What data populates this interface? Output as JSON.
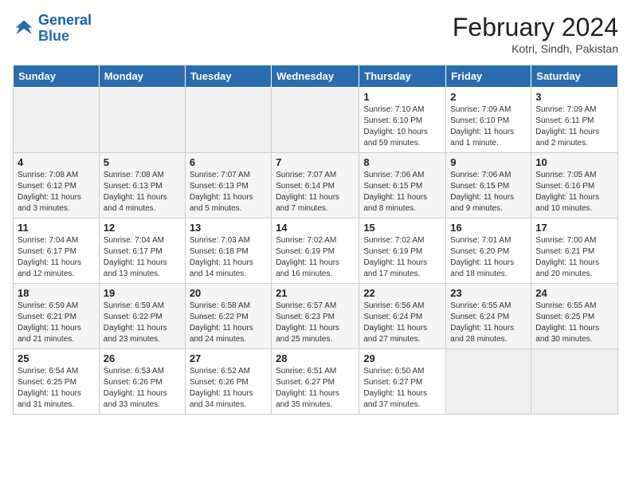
{
  "logo": {
    "line1": "General",
    "line2": "Blue"
  },
  "title": "February 2024",
  "subtitle": "Kotri, Sindh, Pakistan",
  "headers": [
    "Sunday",
    "Monday",
    "Tuesday",
    "Wednesday",
    "Thursday",
    "Friday",
    "Saturday"
  ],
  "weeks": [
    [
      {
        "num": "",
        "info": ""
      },
      {
        "num": "",
        "info": ""
      },
      {
        "num": "",
        "info": ""
      },
      {
        "num": "",
        "info": ""
      },
      {
        "num": "1",
        "info": "Sunrise: 7:10 AM\nSunset: 6:10 PM\nDaylight: 10 hours and 59 minutes."
      },
      {
        "num": "2",
        "info": "Sunrise: 7:09 AM\nSunset: 6:10 PM\nDaylight: 11 hours and 1 minute."
      },
      {
        "num": "3",
        "info": "Sunrise: 7:09 AM\nSunset: 6:11 PM\nDaylight: 11 hours and 2 minutes."
      }
    ],
    [
      {
        "num": "4",
        "info": "Sunrise: 7:08 AM\nSunset: 6:12 PM\nDaylight: 11 hours and 3 minutes."
      },
      {
        "num": "5",
        "info": "Sunrise: 7:08 AM\nSunset: 6:13 PM\nDaylight: 11 hours and 4 minutes."
      },
      {
        "num": "6",
        "info": "Sunrise: 7:07 AM\nSunset: 6:13 PM\nDaylight: 11 hours and 5 minutes."
      },
      {
        "num": "7",
        "info": "Sunrise: 7:07 AM\nSunset: 6:14 PM\nDaylight: 11 hours and 7 minutes."
      },
      {
        "num": "8",
        "info": "Sunrise: 7:06 AM\nSunset: 6:15 PM\nDaylight: 11 hours and 8 minutes."
      },
      {
        "num": "9",
        "info": "Sunrise: 7:06 AM\nSunset: 6:15 PM\nDaylight: 11 hours and 9 minutes."
      },
      {
        "num": "10",
        "info": "Sunrise: 7:05 AM\nSunset: 6:16 PM\nDaylight: 11 hours and 10 minutes."
      }
    ],
    [
      {
        "num": "11",
        "info": "Sunrise: 7:04 AM\nSunset: 6:17 PM\nDaylight: 11 hours and 12 minutes."
      },
      {
        "num": "12",
        "info": "Sunrise: 7:04 AM\nSunset: 6:17 PM\nDaylight: 11 hours and 13 minutes."
      },
      {
        "num": "13",
        "info": "Sunrise: 7:03 AM\nSunset: 6:18 PM\nDaylight: 11 hours and 14 minutes."
      },
      {
        "num": "14",
        "info": "Sunrise: 7:02 AM\nSunset: 6:19 PM\nDaylight: 11 hours and 16 minutes."
      },
      {
        "num": "15",
        "info": "Sunrise: 7:02 AM\nSunset: 6:19 PM\nDaylight: 11 hours and 17 minutes."
      },
      {
        "num": "16",
        "info": "Sunrise: 7:01 AM\nSunset: 6:20 PM\nDaylight: 11 hours and 18 minutes."
      },
      {
        "num": "17",
        "info": "Sunrise: 7:00 AM\nSunset: 6:21 PM\nDaylight: 11 hours and 20 minutes."
      }
    ],
    [
      {
        "num": "18",
        "info": "Sunrise: 6:59 AM\nSunset: 6:21 PM\nDaylight: 11 hours and 21 minutes."
      },
      {
        "num": "19",
        "info": "Sunrise: 6:59 AM\nSunset: 6:22 PM\nDaylight: 11 hours and 23 minutes."
      },
      {
        "num": "20",
        "info": "Sunrise: 6:58 AM\nSunset: 6:22 PM\nDaylight: 11 hours and 24 minutes."
      },
      {
        "num": "21",
        "info": "Sunrise: 6:57 AM\nSunset: 6:23 PM\nDaylight: 11 hours and 25 minutes."
      },
      {
        "num": "22",
        "info": "Sunrise: 6:56 AM\nSunset: 6:24 PM\nDaylight: 11 hours and 27 minutes."
      },
      {
        "num": "23",
        "info": "Sunrise: 6:55 AM\nSunset: 6:24 PM\nDaylight: 11 hours and 28 minutes."
      },
      {
        "num": "24",
        "info": "Sunrise: 6:55 AM\nSunset: 6:25 PM\nDaylight: 11 hours and 30 minutes."
      }
    ],
    [
      {
        "num": "25",
        "info": "Sunrise: 6:54 AM\nSunset: 6:25 PM\nDaylight: 11 hours and 31 minutes."
      },
      {
        "num": "26",
        "info": "Sunrise: 6:53 AM\nSunset: 6:26 PM\nDaylight: 11 hours and 33 minutes."
      },
      {
        "num": "27",
        "info": "Sunrise: 6:52 AM\nSunset: 6:26 PM\nDaylight: 11 hours and 34 minutes."
      },
      {
        "num": "28",
        "info": "Sunrise: 6:51 AM\nSunset: 6:27 PM\nDaylight: 11 hours and 35 minutes."
      },
      {
        "num": "29",
        "info": "Sunrise: 6:50 AM\nSunset: 6:27 PM\nDaylight: 11 hours and 37 minutes."
      },
      {
        "num": "",
        "info": ""
      },
      {
        "num": "",
        "info": ""
      }
    ]
  ]
}
